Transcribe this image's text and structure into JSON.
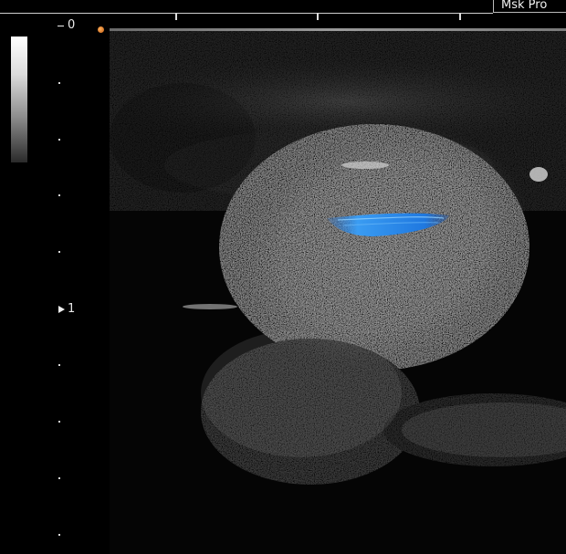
{
  "header": {
    "corner_text": "Msk Pro"
  },
  "depth_scale": {
    "top_label": "0",
    "mid_label": "1"
  },
  "colors": {
    "doppler_blue": "#2f8fe8",
    "focus_marker": "#e07a20"
  },
  "icons": {
    "focus": "focus-marker-icon",
    "depth_arrow": "depth-arrow-icon"
  }
}
